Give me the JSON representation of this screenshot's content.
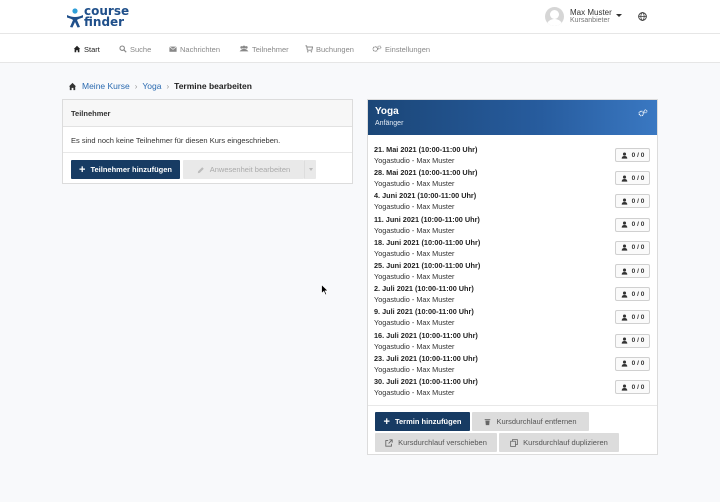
{
  "brand": {
    "line1": "course",
    "line2": "finder",
    "color": "#1f4f8a"
  },
  "user": {
    "name": "Max Muster",
    "role": "Kursanbieter"
  },
  "nav": [
    {
      "label": "Start",
      "icon": "home-icon",
      "active": true
    },
    {
      "label": "Suche",
      "icon": "search-icon",
      "active": false
    },
    {
      "label": "Nachrichten",
      "icon": "envelope-icon",
      "active": false
    },
    {
      "label": "Teilnehmer",
      "icon": "users-icon",
      "active": false
    },
    {
      "label": "Buchungen",
      "icon": "cart-icon",
      "active": false
    },
    {
      "label": "Einstellungen",
      "icon": "gears-icon",
      "active": false
    }
  ],
  "breadcrumb": {
    "item1": "Meine Kurse",
    "item2": "Yoga",
    "current": "Termine bearbeiten"
  },
  "participants": {
    "title": "Teilnehmer",
    "empty_text": "Es sind noch keine Teilnehmer für diesen Kurs eingeschrieben.",
    "add_label": "Teilnehmer hinzufügen",
    "attendance_label": "Anwesenheit bearbeiten"
  },
  "course": {
    "title": "Yoga",
    "level": "Anfänger",
    "sessions": [
      {
        "date": "21. Mai 2021 (10:00-11:00 Uhr)",
        "location": "Yogastudio - Max Muster",
        "count": "0 / 0"
      },
      {
        "date": "28. Mai 2021 (10:00-11:00 Uhr)",
        "location": "Yogastudio - Max Muster",
        "count": "0 / 0"
      },
      {
        "date": "4. Juni 2021 (10:00-11:00 Uhr)",
        "location": "Yogastudio - Max Muster",
        "count": "0 / 0"
      },
      {
        "date": "11. Juni 2021 (10:00-11:00 Uhr)",
        "location": "Yogastudio - Max Muster",
        "count": "0 / 0"
      },
      {
        "date": "18. Juni 2021 (10:00-11:00 Uhr)",
        "location": "Yogastudio - Max Muster",
        "count": "0 / 0"
      },
      {
        "date": "25. Juni 2021 (10:00-11:00 Uhr)",
        "location": "Yogastudio - Max Muster",
        "count": "0 / 0"
      },
      {
        "date": "2. Juli 2021 (10:00-11:00 Uhr)",
        "location": "Yogastudio - Max Muster",
        "count": "0 / 0"
      },
      {
        "date": "9. Juli 2021 (10:00-11:00 Uhr)",
        "location": "Yogastudio - Max Muster",
        "count": "0 / 0"
      },
      {
        "date": "16. Juli 2021 (10:00-11:00 Uhr)",
        "location": "Yogastudio - Max Muster",
        "count": "0 / 0"
      },
      {
        "date": "23. Juli 2021 (10:00-11:00 Uhr)",
        "location": "Yogastudio - Max Muster",
        "count": "0 / 0"
      },
      {
        "date": "30. Juli 2021 (10:00-11:00 Uhr)",
        "location": "Yogastudio - Max Muster",
        "count": "0 / 0"
      }
    ],
    "actions": {
      "add_session": "Termin hinzufügen",
      "remove_run": "Kursdurchlauf entfernen",
      "move_run": "Kursdurchlauf verschieben",
      "duplicate_run": "Kursdurchlauf duplizieren"
    }
  },
  "colors": {
    "primary": "#173b63",
    "link": "#2a6ab0",
    "header_gradient_start": "#1b4677",
    "header_gradient_end": "#3a78c2"
  }
}
